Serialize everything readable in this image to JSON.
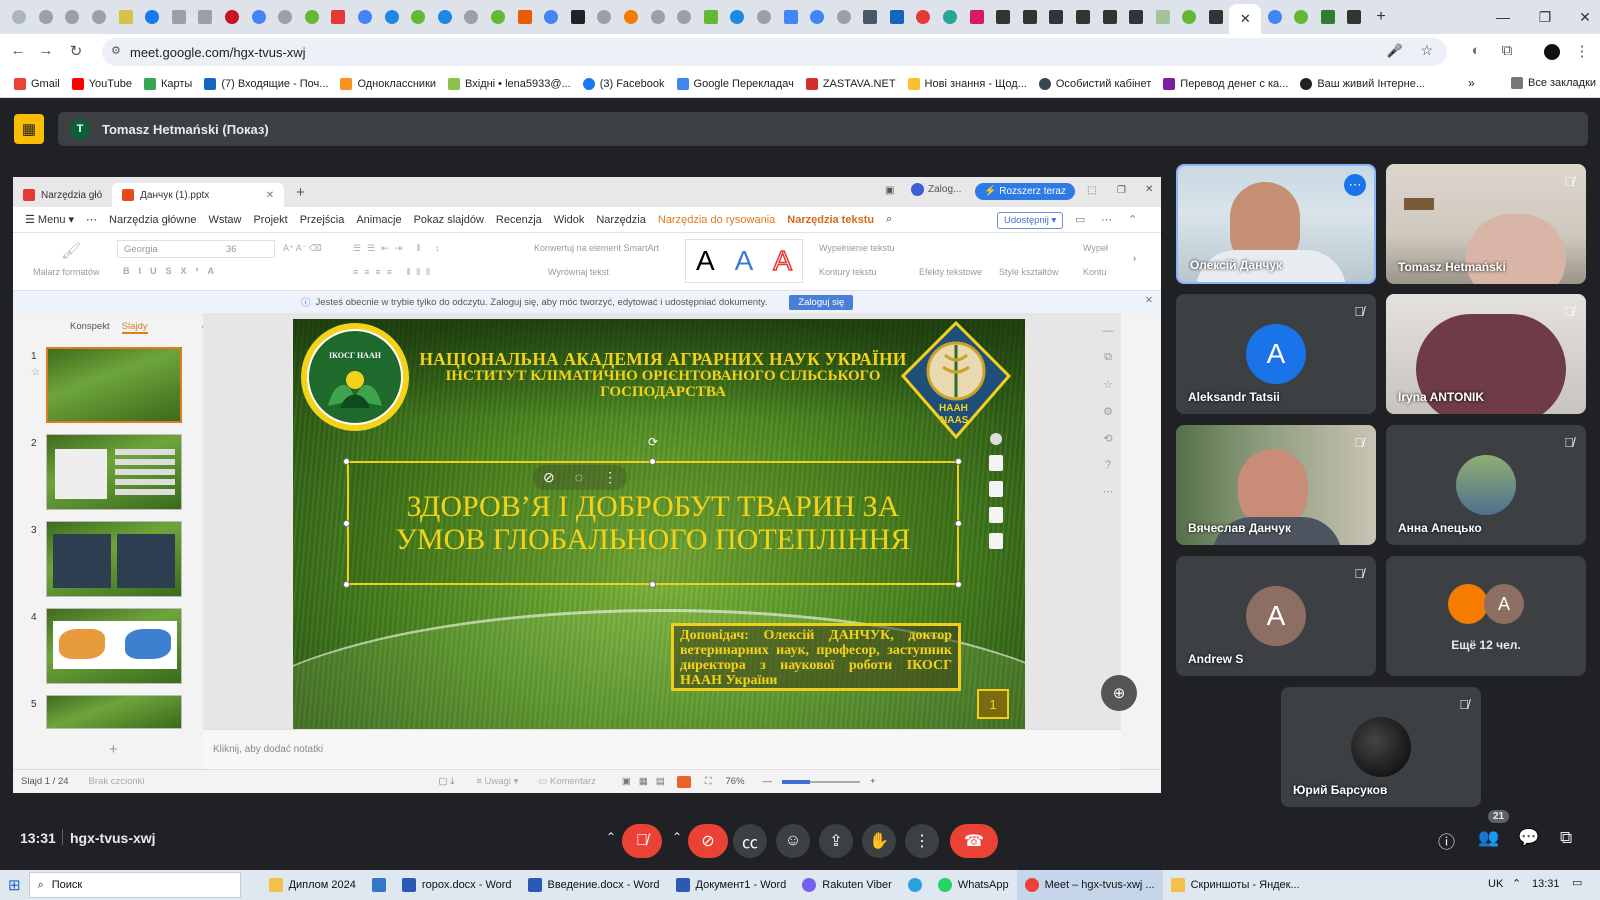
{
  "browser": {
    "url": "meet.google.com/hgx-tvus-xwj",
    "bookmarks": [
      "Gmail",
      "YouTube",
      "Карты",
      "(7) Входящие - Поч...",
      "Одноклассники",
      "Вхідні • lena5933@...",
      "(3) Facebook",
      "Google Перекладач",
      "ZASTAVA.NET",
      "Нові знання - Щод...",
      "Особистий кабінет",
      "Перевод денег с ка...",
      "Ваш живий Інтерне..."
    ],
    "all_bookmarks": "Все закладки"
  },
  "meet": {
    "presenter": "Tomasz Hetmański (Показ)",
    "presenter_initial": "T",
    "time": "13:31",
    "meeting_code": "hgx-tvus-xwj",
    "participants_count": "21",
    "participants": [
      {
        "name": "Олексій Данчук",
        "type": "video"
      },
      {
        "name": "Tomasz Hetmański",
        "type": "video"
      },
      {
        "name": "Aleksandr Tatsii",
        "initial": "A",
        "color": "#1a73e8"
      },
      {
        "name": "Iryna ANTONIK",
        "type": "video"
      },
      {
        "name": "Вячеслав Данчук",
        "type": "video"
      },
      {
        "name": "Анна Апецько",
        "type": "photo"
      },
      {
        "name": "Andrew S",
        "initial": "A",
        "color": "#8d6e63"
      },
      {
        "name": "Ещё 12 чел.",
        "initial": "A",
        "color": "#8d6e63"
      },
      {
        "name": "Юрий Барсуков",
        "type": "photo"
      }
    ]
  },
  "wps": {
    "tab1": "Narzędzia głó",
    "tab2": "Данчук (1).pptx",
    "login": "Zalog...",
    "upgrade": "Rozszerz teraz",
    "share": "Udostępnij",
    "menu": [
      "Menu",
      "Narzędzia główne",
      "Wstaw",
      "Projekt",
      "Przejścia",
      "Animacje",
      "Pokaz slajdów",
      "Recenzja",
      "Widok",
      "Narzędzia"
    ],
    "menu_draw": "Narzędzia do rysowania",
    "menu_text": "Narzędzia tekstu",
    "font": "Georgia",
    "font_size": "36",
    "ribbon_labels": [
      "Malarz formatów",
      "Konwertuj na element SmartArt",
      "Wyrównaj tekst",
      "Wypełnienie tekstu",
      "Kontury tekstu",
      "Efekty tekstowe",
      "Style kształtów",
      "Wypeł",
      "Kontu"
    ],
    "banner_text": "Jesteś obecnie w trybie tylko do odczytu. Zaloguj się, aby móc tworzyć, edytować i udostępniać dokumenty.",
    "banner_btn": "Zaloguj się",
    "pane_tabs": [
      "Konspekt",
      "Slajdy"
    ],
    "thumb_numbers": [
      "1",
      "2",
      "3",
      "4",
      "5"
    ],
    "notes_placeholder": "Kliknij, aby dodać notatki",
    "status_left": "Slajd 1 / 24",
    "status_theme": "Brak czcionki",
    "status_notes": "Uwagi",
    "status_comments": "Komentarz",
    "zoom": "76%"
  },
  "slide": {
    "line1": "НАЦІОНАЛЬНА АКАДЕМІЯ АГРАРНИХ НАУК УКРАЇНИ",
    "line2": "ІНСТИТУТ КЛІМАТИЧНО ОРІЄНТОВАНОГО СІЛЬСЬКОГО ГОСПОДАРСТВА",
    "logo_left": "ІКОСГ НААН",
    "logo_right_1": "НААН",
    "logo_right_2": "NAAS",
    "title": "ЗДОРОВ’Я І ДОБРОБУТ ТВАРИН ЗА УМОВ ГЛОБАЛЬНОГО ПОТЕПЛІННЯ",
    "speaker": "Доповідач: Олексій ДАНЧУК, доктор ветеринарних наук, професор, заступник директора з наукової роботи ІКОСГ НААН України",
    "page_number": "1"
  },
  "taskbar": {
    "search": "Поиск",
    "items": [
      "Диплом 2024",
      "горох.docx - Word",
      "Введение.docx - Word",
      "Документ1 - Word",
      "Rakuten Viber",
      "WhatsApp",
      "Meet – hgx-tvus-xwj ...",
      "Скриншоты - Яндек..."
    ],
    "lang": "UK",
    "clock": "13:31"
  }
}
